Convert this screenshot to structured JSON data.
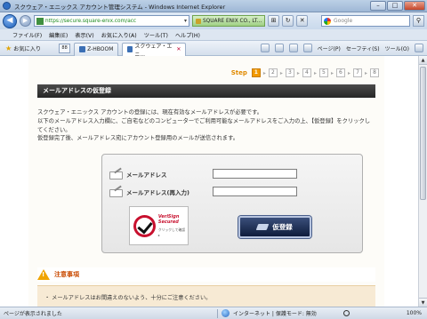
{
  "window": {
    "title": "スクウェア・エニックス アカウント管理システム - Windows Internet Explorer",
    "min": "–",
    "max": "□",
    "close": "✕"
  },
  "address": {
    "back": "◀",
    "forward": "▶",
    "url": "https://secure.square-enix.com/acc",
    "cert": "SQUARE ENIX CO., LT...",
    "search_placeholder": "Google"
  },
  "menu": [
    "ファイル(F)",
    "編集(E)",
    "表示(V)",
    "お気に入り(A)",
    "ツール(T)",
    "ヘルプ(H)"
  ],
  "favorites": {
    "label": "お気に入り",
    "grid": "88",
    "tab_other": "Z-HBOOM",
    "tab_active": "スクウェア・エニ...",
    "tab_close": "✕",
    "commands": [
      "ページ(P)",
      "セーフティ(S)",
      "ツール(O)"
    ]
  },
  "steps": {
    "label": "Step",
    "items": [
      "1",
      "2",
      "3",
      "4",
      "5",
      "6",
      "7",
      "8"
    ],
    "active": "1"
  },
  "section": {
    "title": "メールアドレスの仮登録",
    "desc": [
      "スクウェア・エニックス アカウントの登録には、現在有効なメールアドレスが必要です。",
      "以下のメールアドレス入力欄に、ご自宅などのコンピューターでご利用可能なメールアドレスをご入力の上、【仮登録】をクリックしてください。",
      "仮登録完了後、メールアドレス宛にアカウント登録用のメールが送信されます。"
    ]
  },
  "form": {
    "email_label": "メールアドレス",
    "email_confirm_label": "メールアドレス(再入力)",
    "email_value": "",
    "email_confirm_value": "",
    "submit": "仮登録",
    "verisign_l1": "VeriSign",
    "verisign_l2": "Secured",
    "verisign_l3": "クリックして確認 ▸"
  },
  "notice": {
    "title": "注意事項",
    "body": "・ メールアドレスはお間違えのないよう、十分にご注意ください。"
  },
  "status": {
    "text": "ページが表示されました",
    "zone": "インターネット | 保護モード: 無効",
    "zoom": "100%"
  }
}
